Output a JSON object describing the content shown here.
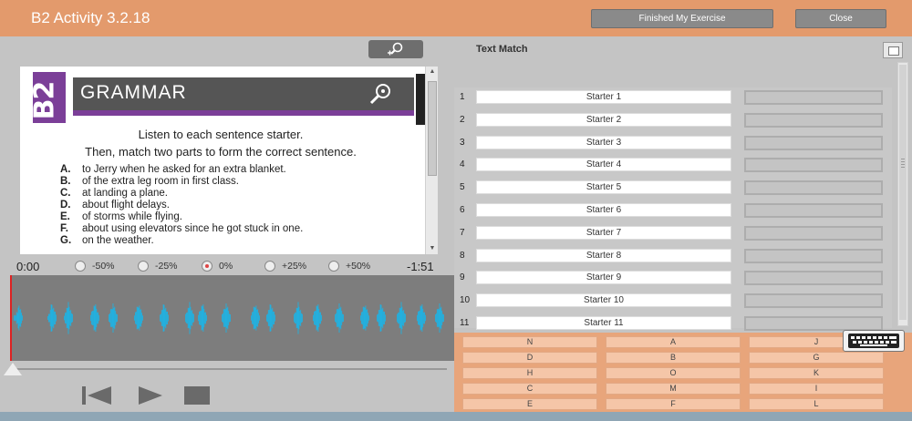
{
  "header": {
    "title": "B2 Activity 3.2.18",
    "finished_label": "Finished My Exercise",
    "close_label": "Close",
    "bg_color": "#e39a6c"
  },
  "document": {
    "badge": "B2",
    "banner_title": "GRAMMAR",
    "instruction_1": "Listen to each sentence starter.",
    "instruction_2": "Then, match two parts to form the correct sentence.",
    "items": [
      {
        "letter": "A.",
        "text": "to Jerry when he asked for an extra blanket."
      },
      {
        "letter": "B.",
        "text": "of the extra leg room in first class."
      },
      {
        "letter": "C.",
        "text": "at landing a plane."
      },
      {
        "letter": "D.",
        "text": "about flight delays."
      },
      {
        "letter": "E.",
        "text": "of storms while flying."
      },
      {
        "letter": "F.",
        "text": "about using elevators since he got stuck in one."
      },
      {
        "letter": "G.",
        "text": "on the weather."
      }
    ],
    "accent_color": "#7b3f98"
  },
  "player": {
    "time_start": "0:00",
    "time_end": "-1:51",
    "speeds": [
      "-50%",
      "-25%",
      "0%",
      "+25%",
      "+50%"
    ],
    "selected_speed": "0%",
    "position": 0.0,
    "wave_color": "#19b6ea"
  },
  "text_match": {
    "title": "Text Match",
    "rows": [
      {
        "num": "1",
        "starter": "Starter 1"
      },
      {
        "num": "2",
        "starter": "Starter 2"
      },
      {
        "num": "3",
        "starter": "Starter 3"
      },
      {
        "num": "4",
        "starter": "Starter 4"
      },
      {
        "num": "5",
        "starter": "Starter 5"
      },
      {
        "num": "6",
        "starter": "Starter 6"
      },
      {
        "num": "7",
        "starter": "Starter 7"
      },
      {
        "num": "8",
        "starter": "Starter 8"
      },
      {
        "num": "9",
        "starter": "Starter 9"
      },
      {
        "num": "10",
        "starter": "Starter 10"
      },
      {
        "num": "11",
        "starter": "Starter 11"
      }
    ],
    "answer_keys": [
      [
        "N",
        "A",
        "J"
      ],
      [
        "D",
        "B",
        "G"
      ],
      [
        "H",
        "O",
        "K"
      ],
      [
        "C",
        "M",
        "I"
      ],
      [
        "E",
        "F",
        "L"
      ]
    ]
  }
}
